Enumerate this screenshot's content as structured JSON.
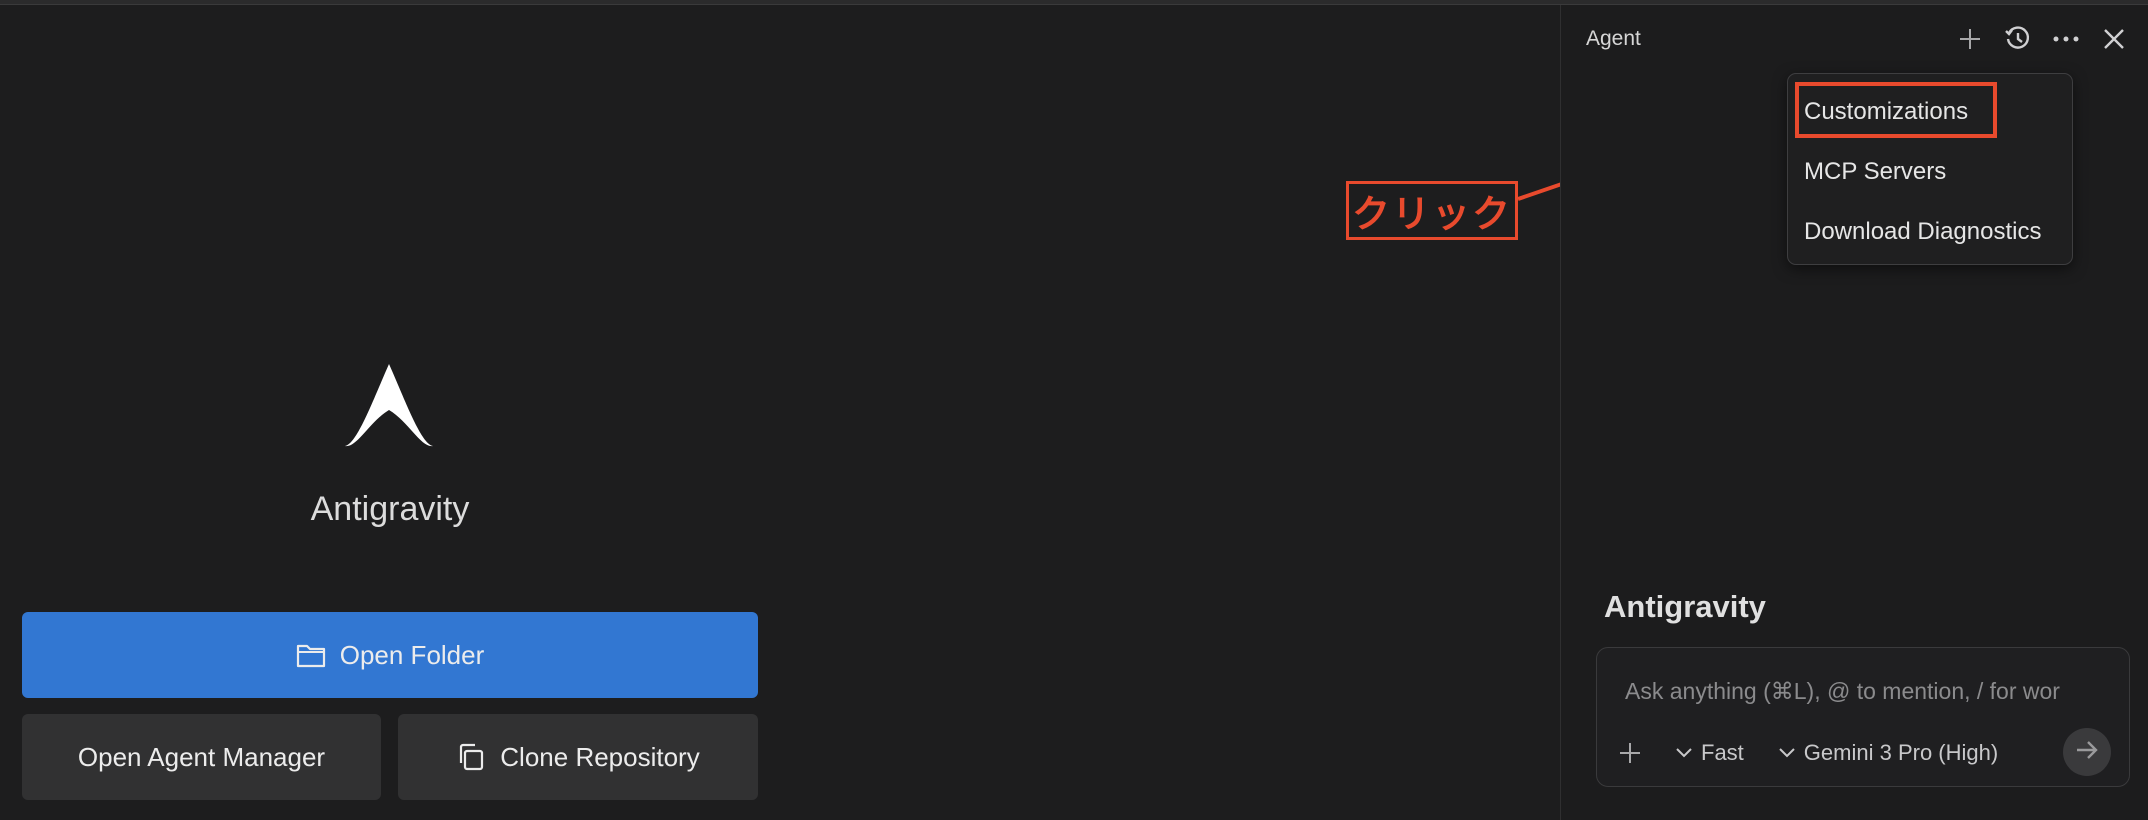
{
  "main": {
    "app_name": "Antigravity",
    "buttons": {
      "open_folder": "Open Folder",
      "open_agent_manager": "Open Agent Manager",
      "clone_repository": "Clone Repository"
    }
  },
  "panel": {
    "title": "Agent",
    "icons": [
      "plus-icon",
      "history-icon",
      "more-icon",
      "close-icon"
    ],
    "menu": {
      "items": [
        "Customizations",
        "MCP Servers",
        "Download Diagnostics"
      ]
    },
    "brand": "Antigravity",
    "chat": {
      "placeholder": "Ask anything (⌘L), @ to mention, / for wor",
      "mode": "Fast",
      "model": "Gemini 3 Pro (High)"
    }
  },
  "annotation": {
    "label": "クリック"
  },
  "colors": {
    "primary_button": "#3277d2",
    "annotation": "#e84a2d",
    "background": "#1d1d1e"
  }
}
